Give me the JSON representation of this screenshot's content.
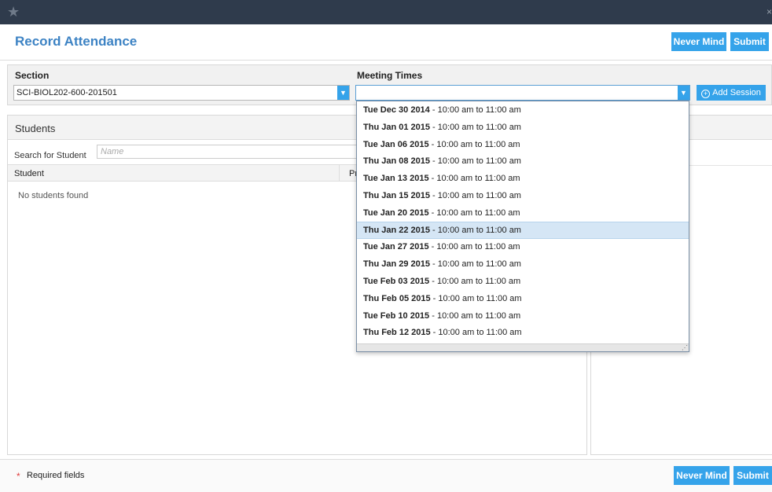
{
  "app": {
    "logo_glyph": "★",
    "close_glyph": "×"
  },
  "header": {
    "title": "Record Attendance"
  },
  "actions": {
    "never_mind": "Never Mind",
    "submit": "Submit"
  },
  "filters": {
    "section_label": "Section",
    "section_value": "SCI-BIOL202-600-201501",
    "meeting_label": "Meeting Times",
    "meeting_value": "",
    "add_session": "Add Session"
  },
  "students": {
    "title": "Students",
    "search_label": "Search for Student",
    "search_placeholder": "Name",
    "col_student": "Student",
    "col_present": "Pr",
    "empty": "No students found"
  },
  "meeting_options": [
    {
      "date": "Tue Dec 30 2014",
      "time": " - 10:00 am to 11:00 am"
    },
    {
      "date": "Thu Jan 01 2015",
      "time": " - 10:00 am to 11:00 am"
    },
    {
      "date": "Tue Jan 06 2015",
      "time": " - 10:00 am to 11:00 am"
    },
    {
      "date": "Thu Jan 08 2015",
      "time": " - 10:00 am to 11:00 am"
    },
    {
      "date": "Tue Jan 13 2015",
      "time": " - 10:00 am to 11:00 am"
    },
    {
      "date": "Thu Jan 15 2015",
      "time": " - 10:00 am to 11:00 am"
    },
    {
      "date": "Tue Jan 20 2015",
      "time": " - 10:00 am to 11:00 am"
    },
    {
      "date": "Thu Jan 22 2015",
      "time": " - 10:00 am to 11:00 am",
      "highlighted": true
    },
    {
      "date": "Tue Jan 27 2015",
      "time": " - 10:00 am to 11:00 am"
    },
    {
      "date": "Thu Jan 29 2015",
      "time": " - 10:00 am to 11:00 am"
    },
    {
      "date": "Tue Feb 03 2015",
      "time": " - 10:00 am to 11:00 am"
    },
    {
      "date": "Thu Feb 05 2015",
      "time": " - 10:00 am to 11:00 am"
    },
    {
      "date": "Tue Feb 10 2015",
      "time": " - 10:00 am to 11:00 am"
    },
    {
      "date": "Thu Feb 12 2015",
      "time": " - 10:00 am to 11:00 am"
    }
  ],
  "footer": {
    "required_marker": "*",
    "required_text": "Required fields"
  },
  "colors": {
    "accent": "#35a3ea",
    "title": "#3d83c4",
    "topbar": "#2f3b4c",
    "highlight": "#d5e6f5",
    "required": "#e03c3c"
  }
}
